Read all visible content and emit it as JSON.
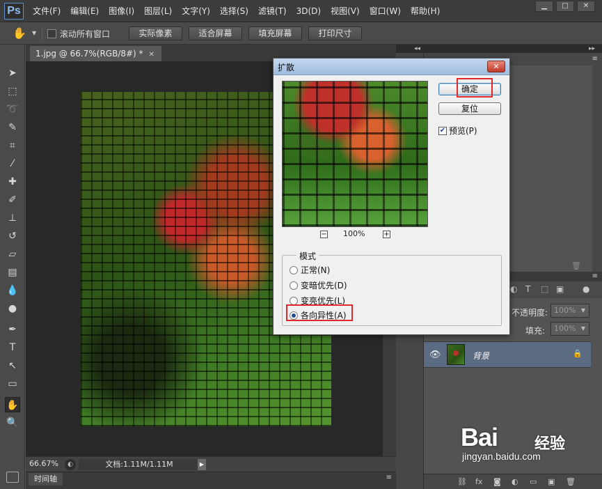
{
  "app": {
    "logo": "Ps",
    "menu": [
      "文件(F)",
      "编辑(E)",
      "图像(I)",
      "图层(L)",
      "文字(Y)",
      "选择(S)",
      "滤镜(T)",
      "3D(D)",
      "视图(V)",
      "窗口(W)",
      "帮助(H)"
    ]
  },
  "options": {
    "scroll_all_label": "滚动所有窗口",
    "buttons": [
      "实际像素",
      "适合屏幕",
      "填充屏幕",
      "打印尺寸"
    ]
  },
  "document": {
    "tab_title": "1.jpg @ 66.7%(RGB/8#) *",
    "zoom": "66.67%",
    "doc_info": "文档:1.11M/1.11M",
    "timeline_tab": "时间轴"
  },
  "dialog": {
    "title": "扩散",
    "close_label": "✕",
    "preview_zoom": "100%",
    "ok_label": "确定",
    "reset_label": "复位",
    "preview_label": "预览(P)",
    "preview_checked": true,
    "mode_legend": "模式",
    "modes": [
      {
        "label": "正常(N)",
        "checked": false
      },
      {
        "label": "变暗优先(D)",
        "checked": false
      },
      {
        "label": "变亮优先(L)",
        "checked": false
      },
      {
        "label": "各向异性(A)",
        "checked": true
      }
    ]
  },
  "layers": {
    "opacity_label": "不透明度:",
    "opacity_value": "100%",
    "fill_label": "填充:",
    "fill_value": "100%",
    "layer_name": "背景"
  },
  "watermark": {
    "brand": "Bai",
    "product": "经验",
    "url": "jingyan.baidu.com"
  },
  "colors": {
    "highlight": "#e0282a",
    "selected_layer": "#5b6b82"
  }
}
